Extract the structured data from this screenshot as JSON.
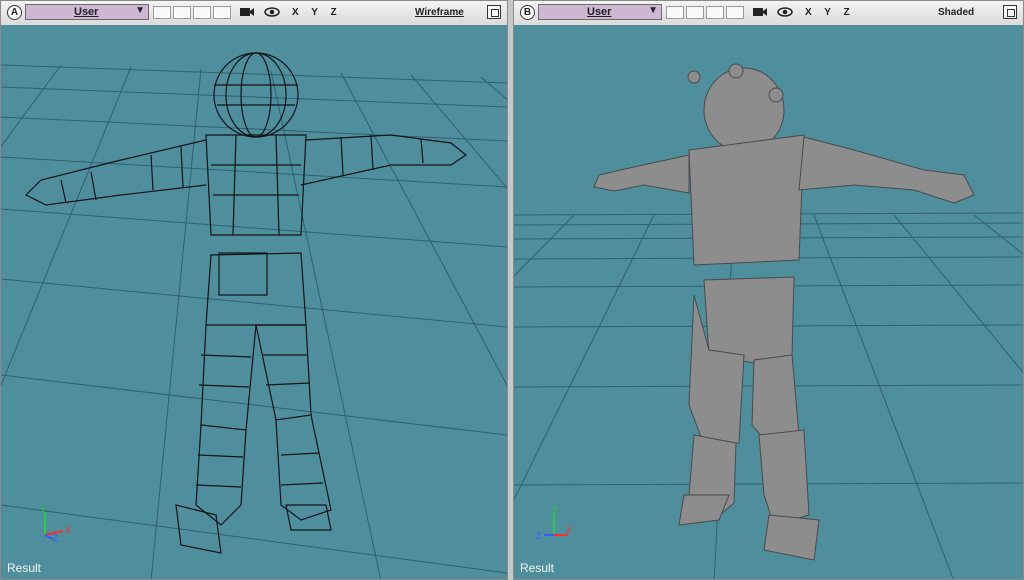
{
  "viewports": [
    {
      "letter": "A",
      "camera": "User",
      "axes": "X Y Z",
      "mode": "Wireframe",
      "status": "Result",
      "gizmo": {
        "x": "X",
        "y": "Y",
        "z": "Z"
      }
    },
    {
      "letter": "B",
      "camera": "User",
      "axes": "X Y Z",
      "mode": "Shaded",
      "status": "Result",
      "gizmo": {
        "x": "X",
        "y": "Y",
        "z": "Z"
      }
    }
  ],
  "colors": {
    "viewport_bg": "#4f8e9c",
    "grid": "#2f6170",
    "wire": "#101418",
    "shaded": "#8d8d8d",
    "camera_field": "#cdb7d3"
  },
  "icons": [
    "viewport-letter-icon",
    "dropdown-arrow-icon",
    "camera-icon",
    "eye-icon",
    "maximize-icon",
    "axis-gizmo-icon"
  ]
}
